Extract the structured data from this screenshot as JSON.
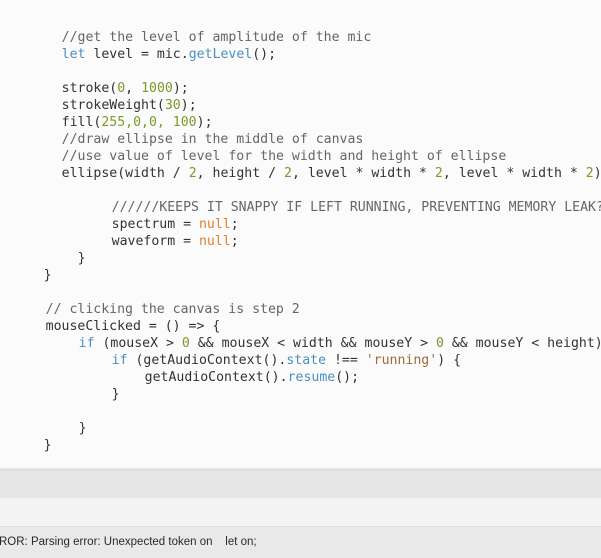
{
  "code": {
    "l1": "//get the level of amplitude of the mic",
    "l2_kw": "let",
    "l2_a": " level = mic.",
    "l2_fn": "getLevel",
    "l2_b": "();",
    "l3_a": "stroke(",
    "l3_n1": "0",
    "l3_b": ", ",
    "l3_n2": "1000",
    "l3_c": ");",
    "l4_a": "strokeWeight(",
    "l4_n": "30",
    "l4_b": ");",
    "l5_a": "fill(",
    "l5_n": "255,0,0, 100",
    "l5_b": ");",
    "l6": "//draw ellipse in the middle of canvas",
    "l7": "//use value of level for the width and height of ellipse",
    "l8_a": "ellipse(width / ",
    "l8_n1": "2",
    "l8_b": ", height / ",
    "l8_n2": "2",
    "l8_c": ", level * width * ",
    "l8_n3": "2",
    "l8_d": ", level * width * ",
    "l8_n4": "2",
    "l8_e": ");",
    "l9": "//////KEEPS IT SNAPPY IF LEFT RUNNING, PREVENTING MEMORY LEAK?",
    "l10_a": "spectrum = ",
    "l10_v": "null",
    "l10_b": ";",
    "l11_a": "waveform = ",
    "l11_v": "null",
    "l11_b": ";",
    "l12": "}",
    "l13": "}",
    "l14": "// clicking the canvas is step 2",
    "l15": "mouseClicked = () => {",
    "l16_kw": "if",
    "l16_a": " (mouseX > ",
    "l16_n1": "0",
    "l16_b": " && mouseX < width && mouseY > ",
    "l16_n2": "0",
    "l16_c": " && mouseY < height) {",
    "l17_kw": "if",
    "l17_a": " (getAudioContext().",
    "l17_prop": "state",
    "l17_b": " !== ",
    "l17_str": "'running'",
    "l17_c": ") {",
    "l18_a": "getAudioContext().",
    "l18_fn": "resume",
    "l18_b": "();",
    "l19": "}",
    "l20": "}",
    "l21": "}"
  },
  "console": {
    "error": "ROR: Parsing error: Unexpected token on    let on;"
  },
  "colors": {
    "comment": "#666666",
    "keyword": "#4b8fc0",
    "number": "#7a9a2b",
    "string": "#9c6d38",
    "null_literal": "#e0832c"
  }
}
